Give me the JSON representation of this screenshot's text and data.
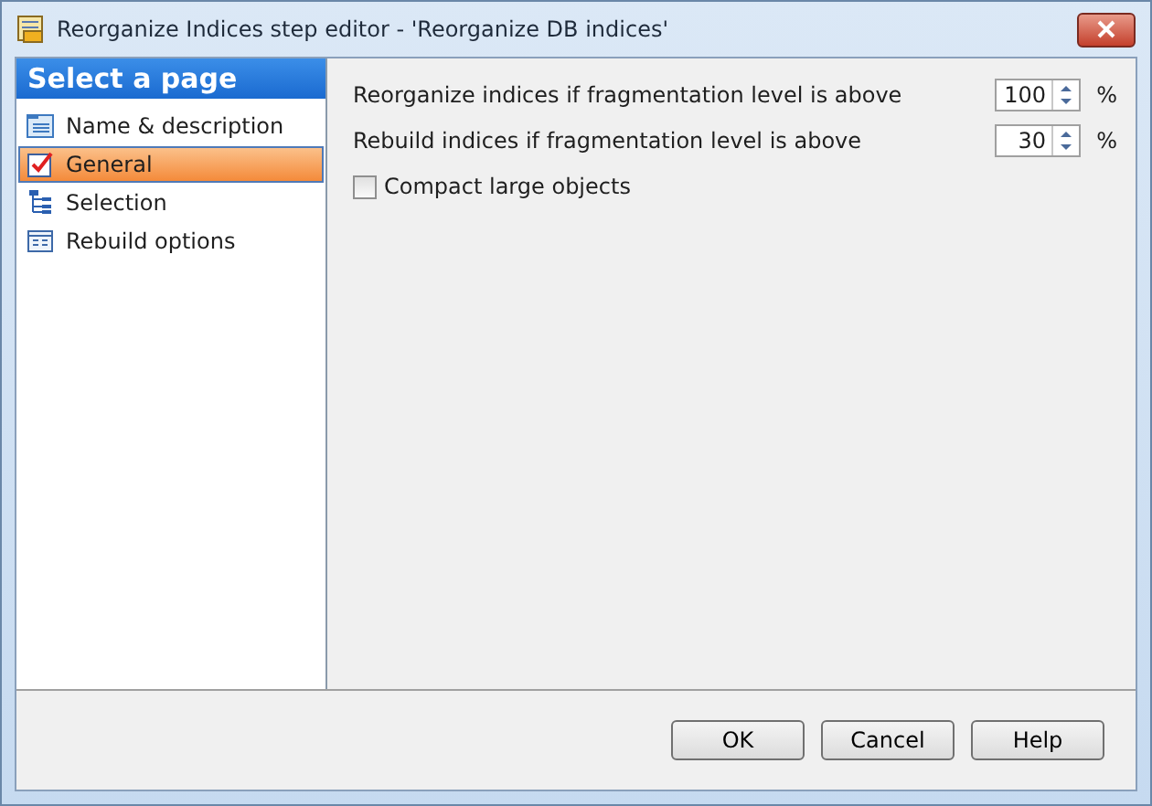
{
  "window": {
    "title": "Reorganize Indices step editor - 'Reorganize DB indices'"
  },
  "sidebar": {
    "header": "Select a page",
    "items": [
      {
        "label": "Name & description",
        "selected": false
      },
      {
        "label": "General",
        "selected": true
      },
      {
        "label": "Selection",
        "selected": false
      },
      {
        "label": "Rebuild options",
        "selected": false
      }
    ]
  },
  "settings": [
    {
      "kind": "spinner",
      "label": "Reorganize indices if fragmentation level is above",
      "value": "100",
      "unit": "%"
    },
    {
      "kind": "spinner",
      "label": "Rebuild indices if fragmentation level is above",
      "value": "30",
      "unit": "%"
    },
    {
      "kind": "checkbox",
      "label": "Compact large objects",
      "checked": false
    }
  ],
  "buttons": [
    "OK",
    "Cancel",
    "Help"
  ]
}
